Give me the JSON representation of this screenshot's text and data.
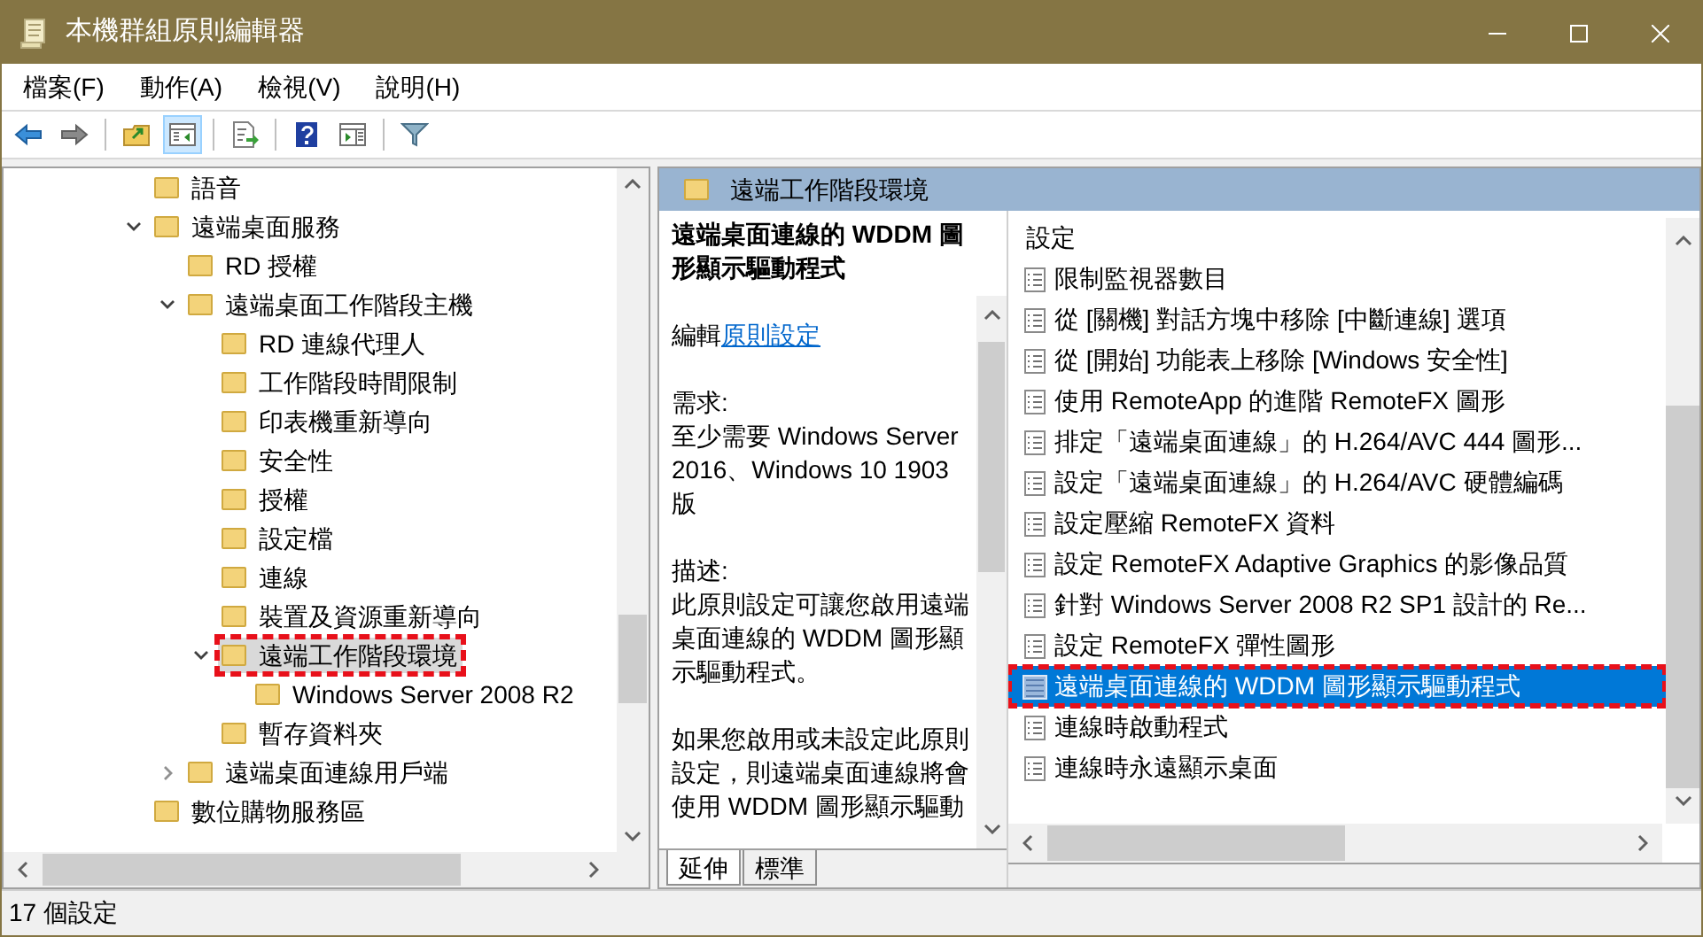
{
  "window": {
    "title": "本機群組原則編輯器"
  },
  "menu": [
    "檔案(F)",
    "動作(A)",
    "檢視(V)",
    "說明(H)"
  ],
  "toolbar": [
    {
      "kind": "back",
      "pressed": false
    },
    {
      "kind": "forward",
      "pressed": false
    },
    {
      "kind": "sep"
    },
    {
      "kind": "up",
      "pressed": false
    },
    {
      "kind": "tree",
      "pressed": true
    },
    {
      "kind": "sep"
    },
    {
      "kind": "export",
      "pressed": false
    },
    {
      "kind": "sep"
    },
    {
      "kind": "help",
      "pressed": false
    },
    {
      "kind": "pane",
      "pressed": false
    },
    {
      "kind": "sep"
    },
    {
      "kind": "filter",
      "pressed": false
    }
  ],
  "tree": [
    {
      "label": "語音",
      "selected": false,
      "highlighted": false
    },
    {
      "label": "遠端桌面服務",
      "selected": false,
      "highlighted": false,
      "expanded": true,
      "children": [
        {
          "label": "RD 授權",
          "selected": false,
          "highlighted": false
        },
        {
          "label": "遠端桌面工作階段主機",
          "selected": false,
          "highlighted": false,
          "expanded": true,
          "children": [
            {
              "label": "RD 連線代理人",
              "selected": false,
              "highlighted": false
            },
            {
              "label": "工作階段時間限制",
              "selected": false,
              "highlighted": false
            },
            {
              "label": "印表機重新導向",
              "selected": false,
              "highlighted": false
            },
            {
              "label": "安全性",
              "selected": false,
              "highlighted": false
            },
            {
              "label": "授權",
              "selected": false,
              "highlighted": false
            },
            {
              "label": "設定檔",
              "selected": false,
              "highlighted": false
            },
            {
              "label": "連線",
              "selected": false,
              "highlighted": false
            },
            {
              "label": "裝置及資源重新導向",
              "selected": false,
              "highlighted": false
            },
            {
              "label": "遠端工作階段環境",
              "selected": true,
              "highlighted": true,
              "expanded": true,
              "children": [
                {
                  "label": "Windows Server 2008 R2",
                  "selected": false,
                  "highlighted": false
                }
              ]
            },
            {
              "label": "暫存資料夾",
              "selected": false,
              "highlighted": false
            }
          ]
        },
        {
          "label": "遠端桌面連線用戶端",
          "selected": false,
          "highlighted": false,
          "expanded": false
        }
      ]
    },
    {
      "label": "數位購物服務區",
      "selected": false,
      "highlighted": false
    }
  ],
  "panel_header": "遠端工作階段環境",
  "description": {
    "title": "遠端桌面連線的 WDDM 圖形顯示驅動程式",
    "edit_prefix": "編輯",
    "edit_link": "原則設定",
    "requirements_label": "需求:",
    "requirements": "至少需要 Windows Server 2016、Windows 10 1903 版",
    "description_label": "描述:",
    "paragraphs": [
      "此原則設定可讓您啟用遠端桌面連線的 WDDM 圖形顯示驅動程式。",
      "如果您啟用或未設定此原則設定，則遠端桌面連線將會使用 WDDM 圖形顯示驅動"
    ]
  },
  "list": {
    "column": "設定",
    "rows": [
      {
        "label": "限制監視器數目",
        "selected": false,
        "highlighted": false
      },
      {
        "label": "從 [關機] 對話方塊中移除 [中斷連線] 選項",
        "selected": false,
        "highlighted": false
      },
      {
        "label": "從 [開始] 功能表上移除 [Windows 安全性]",
        "selected": false,
        "highlighted": false
      },
      {
        "label": "使用 RemoteApp 的進階 RemoteFX 圖形",
        "selected": false,
        "highlighted": false
      },
      {
        "label": "排定「遠端桌面連線」的 H.264/AVC 444 圖形...",
        "selected": false,
        "highlighted": false
      },
      {
        "label": "設定「遠端桌面連線」的 H.264/AVC 硬體編碼",
        "selected": false,
        "highlighted": false
      },
      {
        "label": "設定壓縮 RemoteFX 資料",
        "selected": false,
        "highlighted": false
      },
      {
        "label": "設定 RemoteFX Adaptive Graphics 的影像品質",
        "selected": false,
        "highlighted": false
      },
      {
        "label": "針對 Windows Server 2008 R2 SP1 設計的 Re...",
        "selected": false,
        "highlighted": false
      },
      {
        "label": "設定 RemoteFX 彈性圖形",
        "selected": false,
        "highlighted": false
      },
      {
        "label": "遠端桌面連線的 WDDM 圖形顯示驅動程式",
        "selected": true,
        "highlighted": true
      },
      {
        "label": "連線時啟動程式",
        "selected": false,
        "highlighted": false
      },
      {
        "label": "連線時永遠顯示桌面",
        "selected": false,
        "highlighted": false
      }
    ]
  },
  "tabs": [
    {
      "label": "延伸",
      "selected": true
    },
    {
      "label": "標準",
      "selected": false
    }
  ],
  "status_bar": "17 個設定"
}
